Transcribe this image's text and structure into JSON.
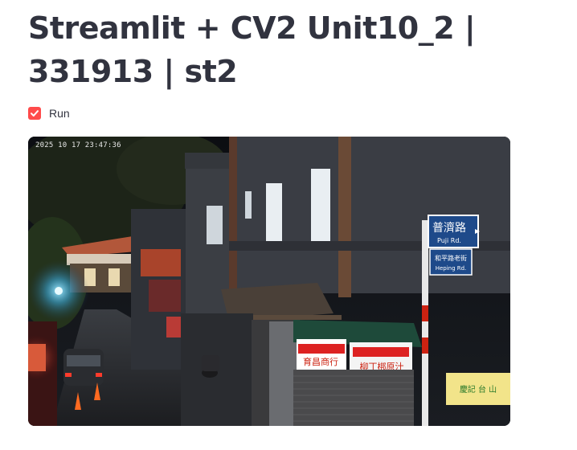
{
  "page": {
    "title": "Streamlit + CV2 Unit10_2 | 331913 | st2"
  },
  "controls": {
    "run_label": "Run",
    "run_checked": true
  },
  "camera": {
    "timestamp": "2025 10 17 23:47:36",
    "signs": {
      "street_name_zh": "普濟路",
      "street_name_en": "Puji Rd.",
      "secondary_zh": "和平路老街",
      "secondary_en": "Heping Rd.",
      "shop_banner_left": "育昌商行",
      "shop_banner_right": "柳丁梆原汁",
      "shop_banner_far_right": "慶記 台 山"
    }
  },
  "colors": {
    "accent": "#ff4b4b",
    "text": "#31333f"
  }
}
